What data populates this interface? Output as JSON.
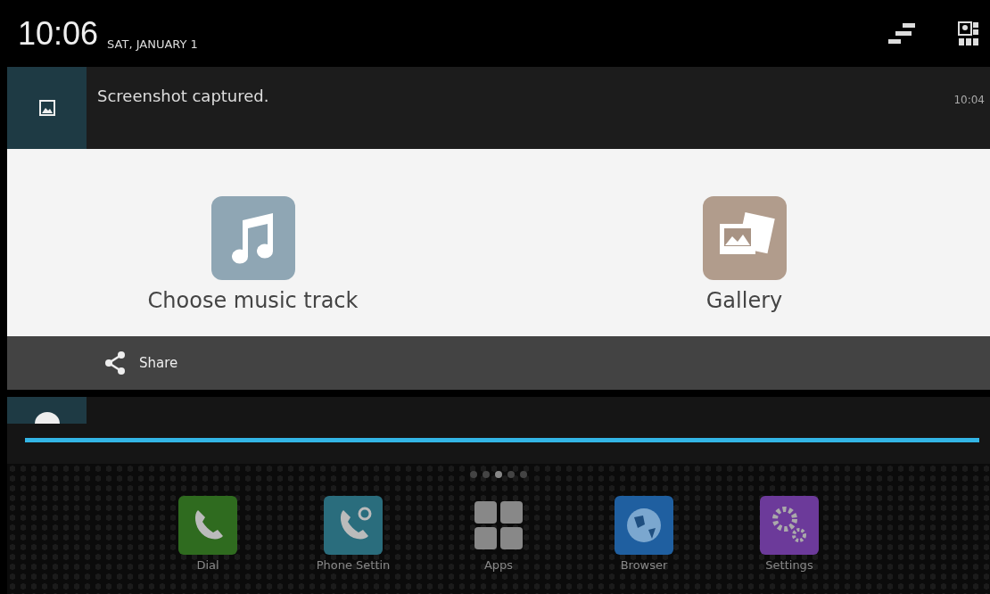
{
  "status_bar": {
    "time": "10:06",
    "date": "SAT, JANUARY 1"
  },
  "notifications": [
    {
      "title": "Screenshot captured.",
      "time": "10:04"
    }
  ],
  "chooser": {
    "options": [
      {
        "label": "Choose music track",
        "kind": "music"
      },
      {
        "label": "Gallery",
        "kind": "gallery"
      }
    ],
    "share": "Share"
  },
  "progress_notification": {
    "level": 1
  },
  "home": {
    "pages": [
      {
        "selected": false
      },
      {
        "selected": false
      },
      {
        "selected": true
      },
      {
        "selected": false
      },
      {
        "selected": false
      }
    ],
    "dock": [
      {
        "label": "Dial",
        "kind": "dial"
      },
      {
        "label": "Phone Settin",
        "kind": "phone-settings"
      },
      {
        "label": "Apps",
        "kind": "apps"
      },
      {
        "label": "Browser",
        "kind": "browser"
      },
      {
        "label": "Settings",
        "kind": "settings"
      }
    ]
  }
}
